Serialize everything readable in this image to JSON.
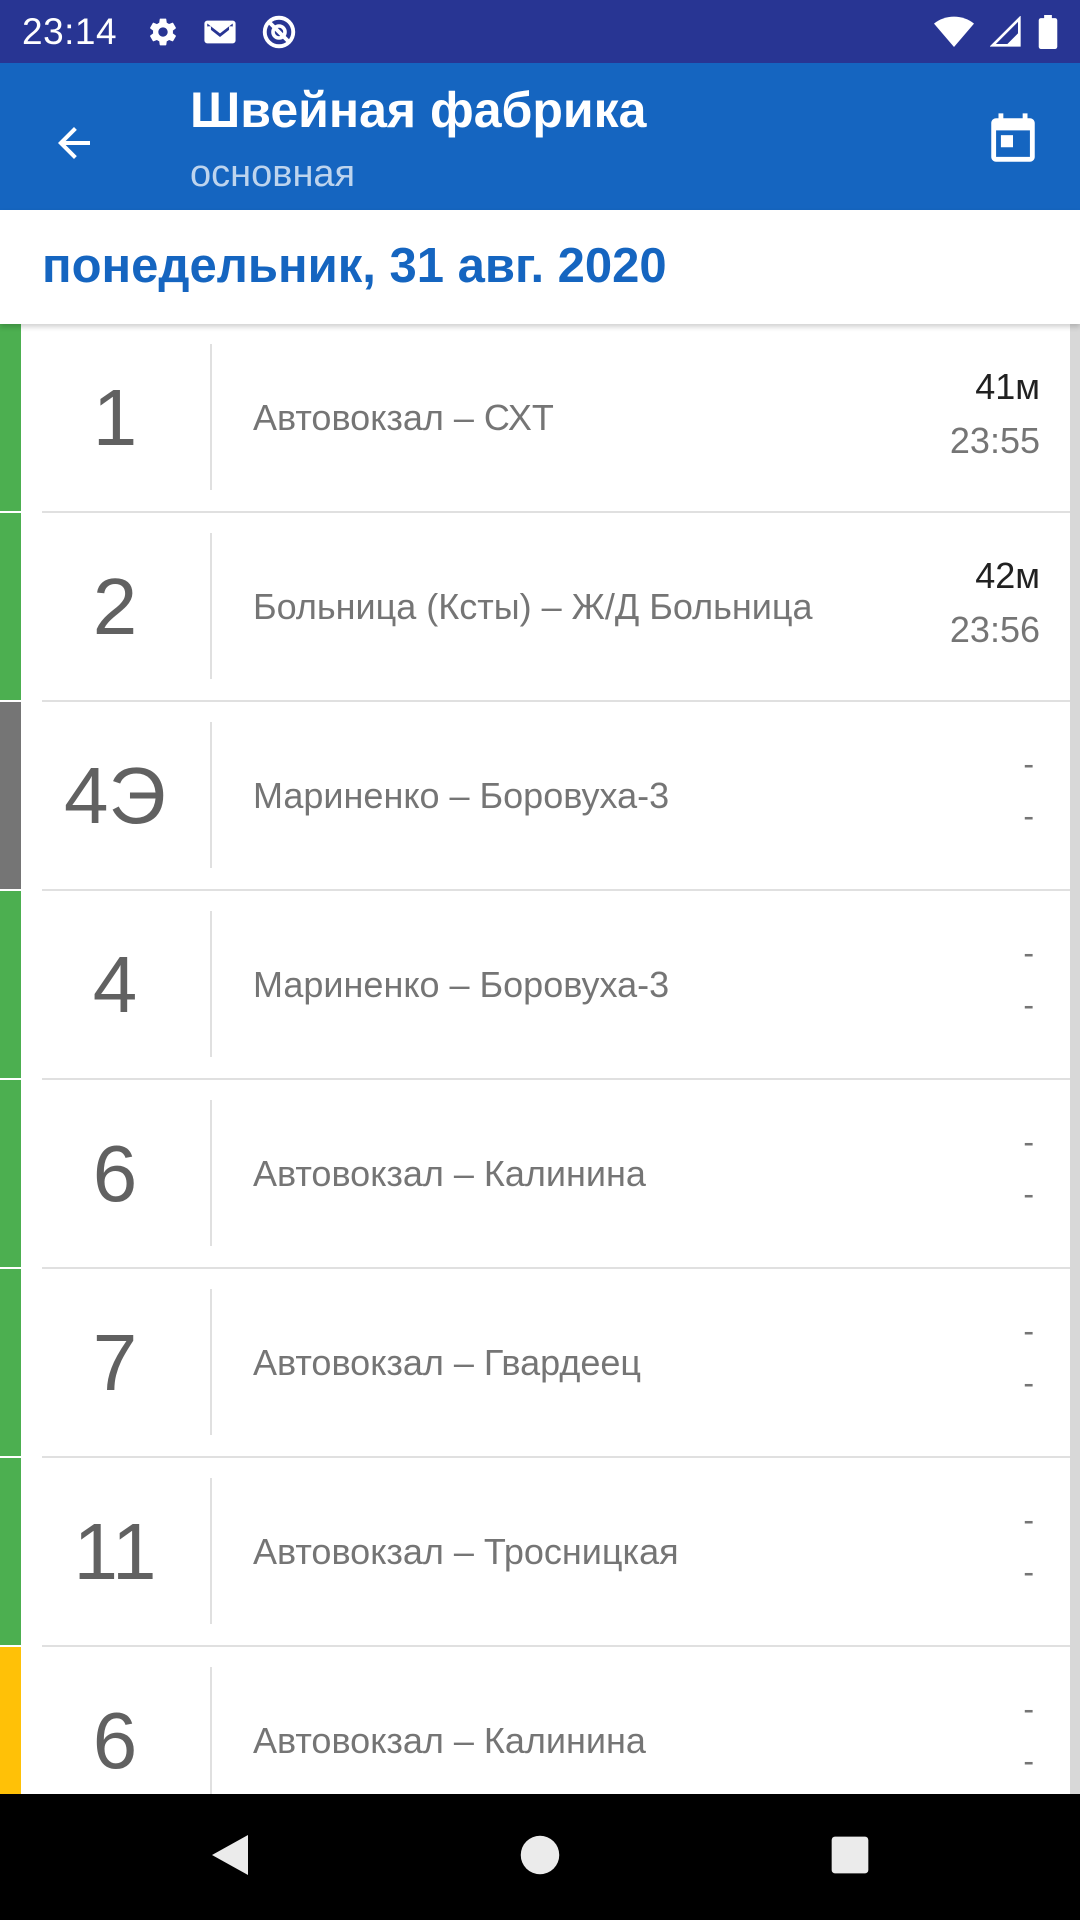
{
  "status_bar": {
    "time": "23:14",
    "icons_left": [
      "gear-icon",
      "gmail-icon",
      "no-disturb-icon"
    ],
    "icons_right": [
      "wifi-icon",
      "signal-icon",
      "battery-icon"
    ]
  },
  "app_bar": {
    "title": "Швейная фабрика",
    "subtitle": "основная",
    "back_icon": "arrow-back-icon",
    "calendar_icon": "calendar-icon"
  },
  "date_header": {
    "date": "понедельник, 31 авг. 2020"
  },
  "routes": [
    {
      "number": "1",
      "name": "Автовокзал – СХТ",
      "arrive_in": "41м",
      "arrive_at": "23:55",
      "color": "#4caf50"
    },
    {
      "number": "2",
      "name": "Больница (Ксты) – Ж/Д Больница",
      "arrive_in": "42м",
      "arrive_at": "23:56",
      "color": "#4caf50"
    },
    {
      "number": "4Э",
      "name": "Мариненко – Боровуха-3",
      "arrive_in": "-",
      "arrive_at": "-",
      "color": "#757575"
    },
    {
      "number": "4",
      "name": "Мариненко – Боровуха-3",
      "arrive_in": "-",
      "arrive_at": "-",
      "color": "#4caf50"
    },
    {
      "number": "6",
      "name": "Автовокзал – Калинина",
      "arrive_in": "-",
      "arrive_at": "-",
      "color": "#4caf50"
    },
    {
      "number": "7",
      "name": "Автовокзал – Гвардеец",
      "arrive_in": "-",
      "arrive_at": "-",
      "color": "#4caf50"
    },
    {
      "number": "11",
      "name": "Автовокзал – Тросницкая",
      "arrive_in": "-",
      "arrive_at": "-",
      "color": "#4caf50"
    },
    {
      "number": "6",
      "name": "Автовокзал – Калинина",
      "arrive_in": "-",
      "arrive_at": "-",
      "color": "#ffc107"
    }
  ],
  "nav_bar": {
    "icons": [
      "nav-back-icon",
      "nav-home-icon",
      "nav-recents-icon"
    ]
  },
  "colors": {
    "status_bar": "#283593",
    "app_bar": "#1565c0",
    "accent": "#1565c0"
  }
}
